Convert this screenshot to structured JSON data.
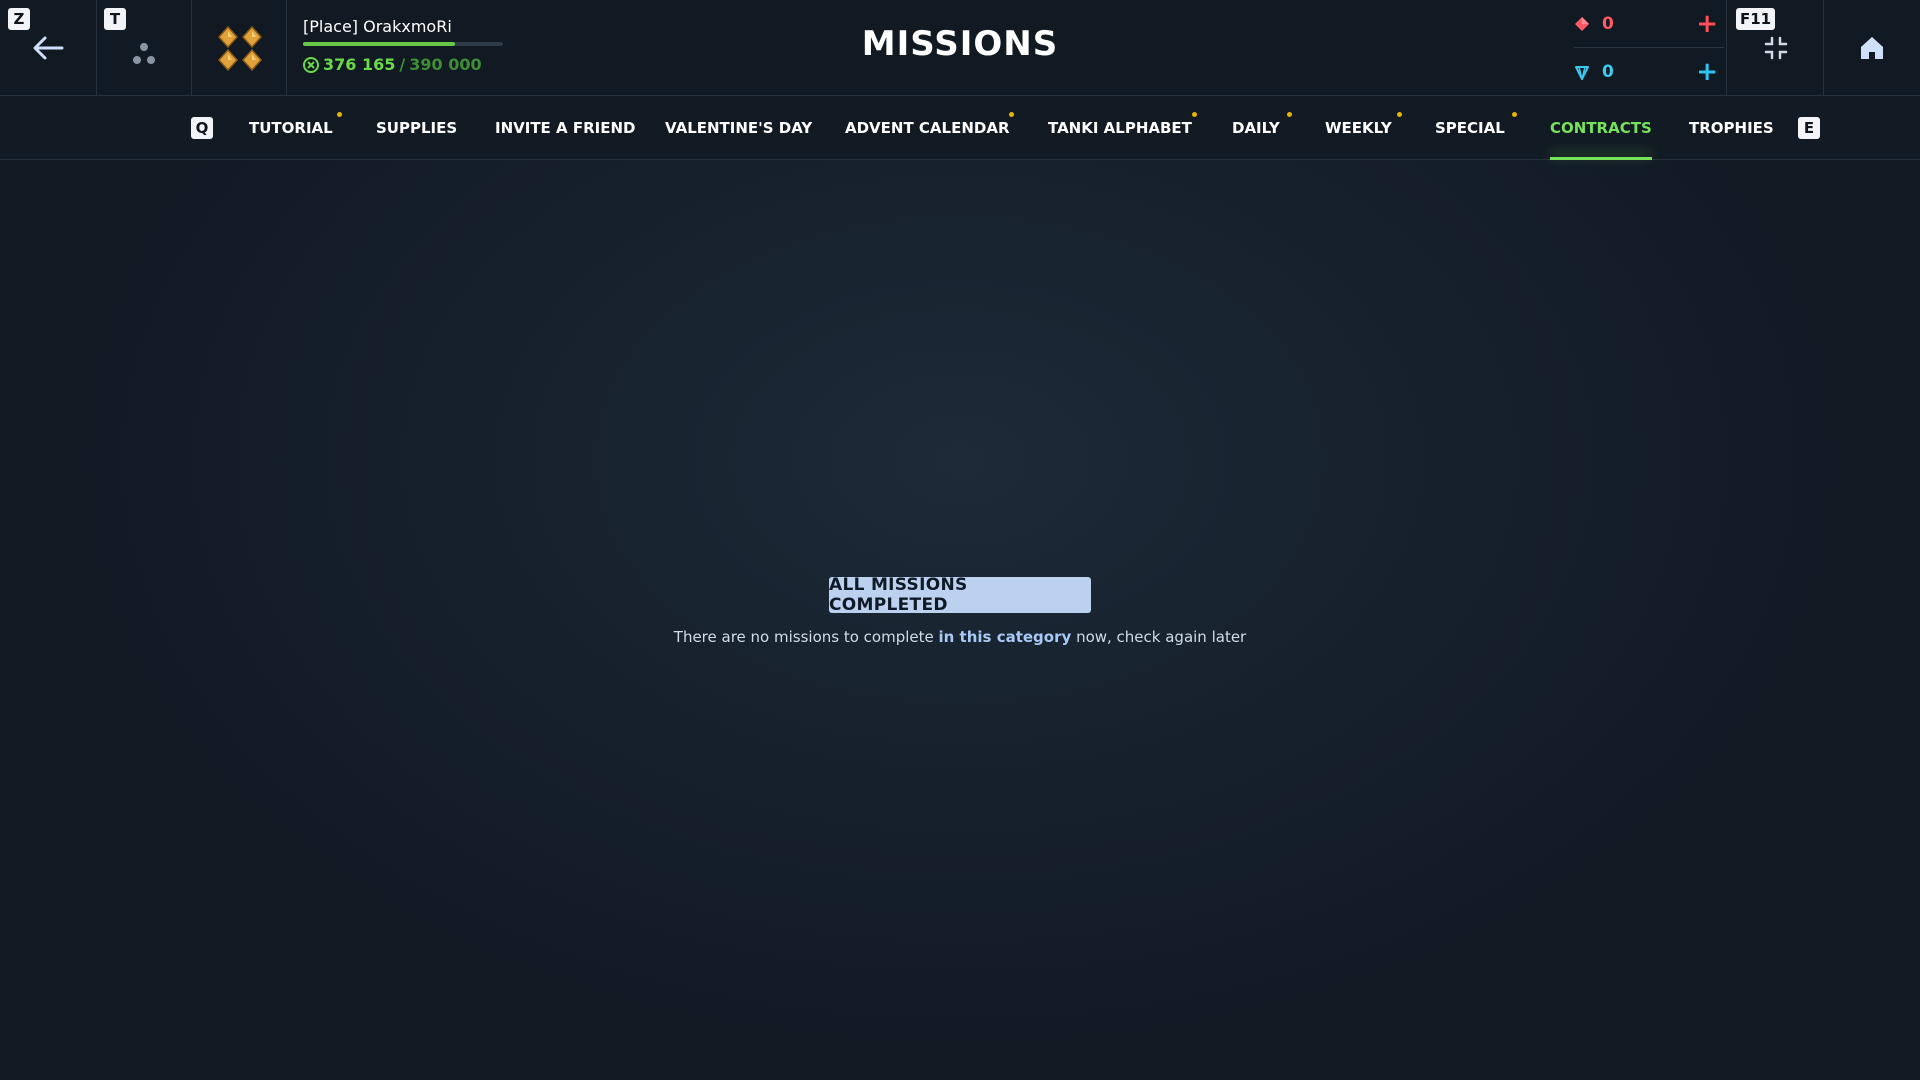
{
  "hotkeys": {
    "back": "Z",
    "friends": "T",
    "prev_tab": "Q",
    "next_tab": "E",
    "fullscreen": "F11"
  },
  "profile": {
    "name": "[Place] OrakxmoRi",
    "xp_current": "376 165",
    "xp_separator": "/",
    "xp_max": "390 000",
    "xp_fraction": 0.7578
  },
  "header": {
    "title": "MISSIONS"
  },
  "currencies": {
    "rubies": "0",
    "crystals": "0",
    "add_symbol": "+"
  },
  "tabs": [
    {
      "label": "TUTORIAL",
      "dot": true
    },
    {
      "label": "SUPPLIES",
      "dot": false
    },
    {
      "label": "INVITE A FRIEND",
      "dot": false
    },
    {
      "label": "VALENTINE'S DAY",
      "dot": false
    },
    {
      "label": "ADVENT CALENDAR",
      "dot": true
    },
    {
      "label": "TANKI ALPHABET",
      "dot": true
    },
    {
      "label": "DAILY",
      "dot": true
    },
    {
      "label": "WEEKLY",
      "dot": true
    },
    {
      "label": "SPECIAL",
      "dot": true
    },
    {
      "label": "CONTRACTS",
      "dot": false,
      "active": true
    },
    {
      "label": "TROPHIES",
      "dot": false
    }
  ],
  "content": {
    "badge": "ALL MISSIONS COMPLETED",
    "msg_prefix": "There are no missions to complete",
    "msg_emphasis": "in this category",
    "msg_suffix": "now, check again later"
  },
  "colors": {
    "accent_green": "#76e35a",
    "ruby": "#ff5a66",
    "crystal": "#3cc8ef",
    "notification_dot": "#e6b300"
  },
  "icons": {
    "back": "arrow-left-icon",
    "friends": "friends-dots-icon",
    "rank": "rank-diamonds-icon",
    "xp": "xp-icon",
    "ruby": "ruby-icon",
    "crystal": "crystal-icon",
    "fullscreen": "exit-fullscreen-icon",
    "home": "home-icon"
  }
}
